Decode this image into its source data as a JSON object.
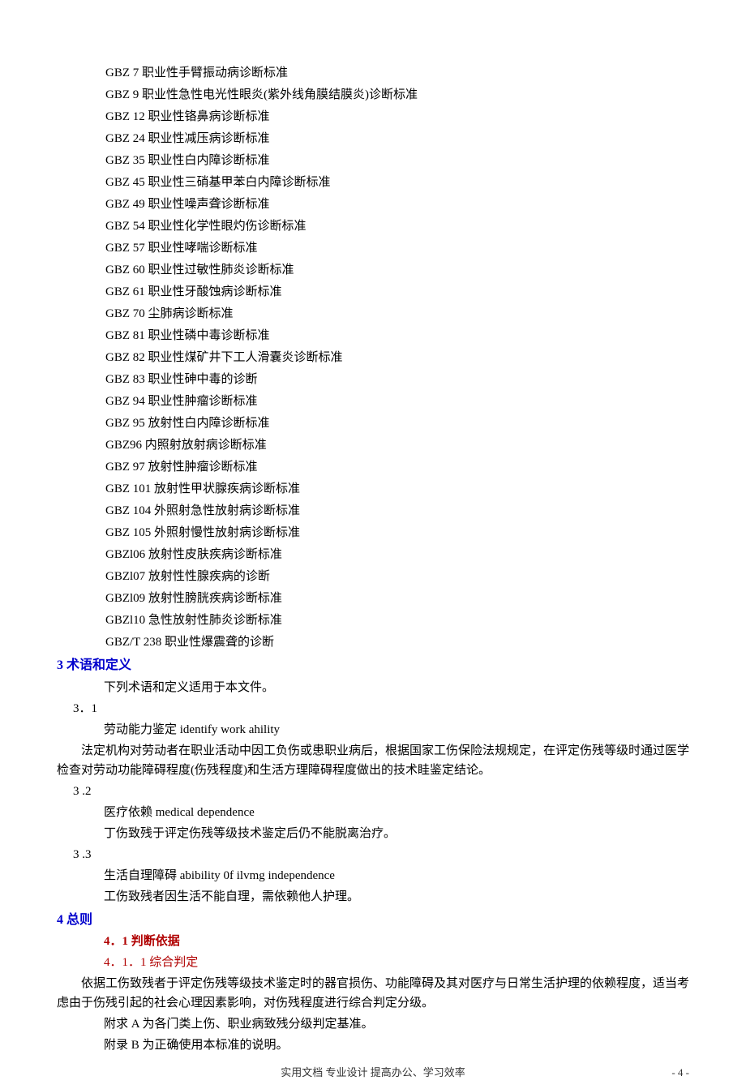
{
  "gbz_items": [
    "GBZ 7 职业性手臂振动病诊断标准",
    "GBZ 9 职业性急性电光性眼炎(紫外线角膜结膜炎)诊断标准",
    "GBZ 12 职业性铬鼻病诊断标准",
    "GBZ 24 职业性减压病诊断标准",
    "GBZ 35 职业性白内障诊断标准",
    "GBZ 45 职业性三硝基甲苯白内障诊断标准",
    "GBZ 49 职业性噪声聋诊断标准",
    "GBZ 54 职业性化学性眼灼伤诊断标准",
    "GBZ 57 职业性哮喘诊断标准",
    "GBZ 60 职业性过敏性肺炎诊断标准",
    "GBZ 61 职业性牙酸蚀病诊断标准",
    "GBZ 70 尘肺病诊断标准",
    "GBZ 81 职业性磷中毒诊断标准",
    "GBZ 82 职业性煤矿井下工人滑囊炎诊断标准",
    "GBZ 83 职业性砷中毒的诊断",
    "GBZ 94 职业性肿瘤诊断标准",
    "GBZ 95 放射性白内障诊断标准",
    "GBZ96 内照射放射病诊断标准",
    "GBZ 97 放射性肿瘤诊断标准",
    "GBZ 101 放射性甲状腺疾病诊断标准",
    "GBZ 104 外照射急性放射病诊断标准",
    "GBZ 105 外照射慢性放射病诊断标准",
    "GBZl06 放射性皮肤疾病诊断标准",
    "GBZl07 放射性性腺疾病的诊断",
    "GBZl09 放射性膀胱疾病诊断标准",
    "GBZl10 急性放射性肺炎诊断标准",
    "GBZ/T 238 职业性爆震聋的诊断"
  ],
  "section3": {
    "title": "3 术语和定义",
    "intro": "下列术语和定义适用于本文件。",
    "items": [
      {
        "num": "3．1",
        "term": "劳动能力鉴定 identify work ahility",
        "desc": "法定机构对劳动者在职业活动中因工负伤或患职业病后，根据国家工伤保险法规规定，在评定伤残等级时通过医学检查对劳动功能障碍程度(伤残程度)和生活方理障碍程度做出的技术眭鉴定结论。"
      },
      {
        "num": "3 .2",
        "term": "医疗依赖 medical dependence",
        "desc": "丁伤致残于评定伤残等级技术鉴定后仍不能脱离治疗。"
      },
      {
        "num": "3 .3",
        "term": "生活自理障碍 abibility 0f ilvmg independence",
        "desc": "工伤致残者因生活不能自理，需依赖他人护理。"
      }
    ]
  },
  "section4": {
    "title": "4 总则",
    "sub41": "4．1 判断依据",
    "sub411": "4．1．1 综合判定",
    "para411": "依据工伤致残者于评定伤残等级技术鉴定时的器官损伤、功能障碍及其对医疗与日常生活护理的依赖程度，适当考虑由于伤残引起的社会心理因素影响，对伤残程度进行综合判定分级。",
    "appendixA": "附求 A 为各门类上伤、职业病致残分级判定基准。",
    "appendixB": "附录 B 为正确使用本标准的说明。"
  },
  "footer": {
    "center": "实用文档 专业设计 提高办公、学习效率",
    "page": "- 4 -"
  }
}
